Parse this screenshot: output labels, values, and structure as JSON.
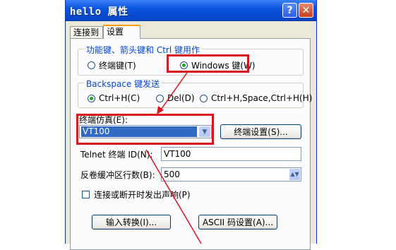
{
  "window": {
    "title": "hello 属性",
    "help_glyph": "?",
    "close_glyph": "✕"
  },
  "tabs": [
    {
      "label": "连接到",
      "selected": false
    },
    {
      "label": "设置",
      "selected": true
    }
  ],
  "function_keys_group": {
    "legend": "功能键、箭头键和 Ctrl 键用作",
    "options": [
      {
        "label": "终端键(T)",
        "selected": false
      },
      {
        "label": "Windows 键(W)",
        "selected": true
      }
    ]
  },
  "backspace_group": {
    "legend": "Backspace 键发送",
    "options": [
      {
        "label": "Ctrl+H(C)",
        "selected": true
      },
      {
        "label": "Del(D)",
        "selected": false
      },
      {
        "label": "Ctrl+H,Space,Ctrl+H(H)",
        "selected": false
      }
    ]
  },
  "emulation": {
    "label": "终端仿真(E):",
    "value": "VT100",
    "settings_button": "终端设置(S)..."
  },
  "telnet_id": {
    "label": "Telnet 终端 ID(N):",
    "value": "VT100"
  },
  "backscroll": {
    "label": "反卷缓冲区行数(B):",
    "value": "500"
  },
  "beep_checkbox": {
    "label": "连接或断开时发出声响(P)",
    "checked": false
  },
  "buttons": {
    "input_translation": "输入转换(I)...",
    "ascii_setup": "ASCII 码设置(A)..."
  },
  "colors": {
    "annotation_red": "#d9141c",
    "title_blue": "#0a55e0",
    "legend_blue": "#0046d5",
    "selection_blue": "#316ac5"
  }
}
